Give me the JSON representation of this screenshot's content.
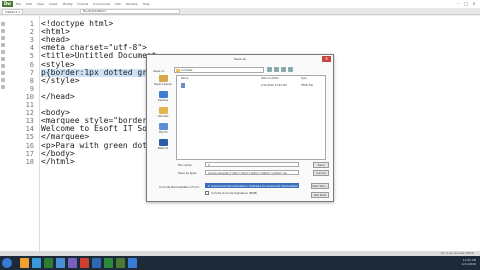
{
  "app": {
    "logo": "Dw",
    "menus": [
      "File",
      "Edit",
      "View",
      "Insert",
      "Modify",
      "Format",
      "Commands",
      "Site",
      "Window",
      "Help"
    ],
    "window_controls": [
      "–",
      "□",
      "✕"
    ]
  },
  "toolbar": {
    "doc_tab": "Untitled-1",
    "file_path": "file:///C|/Untitled-1",
    "doc_tab_close": "×"
  },
  "editor": {
    "lines": [
      {
        "num": "1",
        "text": "<!doctype html>"
      },
      {
        "num": "2",
        "text": "<html>"
      },
      {
        "num": "3",
        "text": "<head>"
      },
      {
        "num": "4",
        "text": "<meta charset=\"utf-8\">"
      },
      {
        "num": "5",
        "text": "<title>Untitled Document"
      },
      {
        "num": "6",
        "text": "<style>"
      },
      {
        "num": "7",
        "text": "p{border:1px dotted gree"
      },
      {
        "num": "8",
        "text": "</style>"
      },
      {
        "num": "9",
        "text": ""
      },
      {
        "num": "10",
        "text": "</head>"
      },
      {
        "num": "11",
        "text": ""
      },
      {
        "num": "12",
        "text": "<body>"
      },
      {
        "num": "13",
        "text": "<marquee style=\"border:2"
      },
      {
        "num": "14",
        "text": "Welcome to Esoft IT Solu"
      },
      {
        "num": "15",
        "text": "</marquee>"
      },
      {
        "num": "16",
        "text": "<p>Para with green dotte"
      },
      {
        "num": "17",
        "text": "</body>"
      },
      {
        "num": "18",
        "text": "</html>"
      }
    ]
  },
  "dialog": {
    "title": "Save As",
    "close": "✕",
    "save_in_label": "Save in:",
    "save_in_value": "number",
    "places": [
      "Recent places",
      "Desktop",
      "Libraries",
      "This PC",
      "Network"
    ],
    "columns": {
      "name": "Name",
      "date": "Date modified",
      "type": "Type"
    },
    "file_row": {
      "date": "1/11/2016 11:03 AM",
      "type": "HTML File"
    },
    "file_name_label": "File name:",
    "file_name_value": "2",
    "save_as_type_label": "Save as type:",
    "save_as_type_value": "All Documents (*.htm;*.html;*.shtm;*.shtml;*.xhtml;*.sh",
    "unicode_label": "Unicode Normalization Form:",
    "unicode_value": "C (Canonical Decomposition, followed by Canonical Composition)",
    "bom_label": "Include Unicode Signature (BOM)",
    "save_btn": "Save",
    "cancel_btn": "Cancel",
    "new_site_btn": "New Site...",
    "site_root_btn": "Site Root"
  },
  "statusbar": {
    "text": "1K / 1 sec  Unicode (UTF-8)"
  },
  "taskbar": {
    "time": "11:05 AM",
    "date": "1/11/2016",
    "icon_colors": [
      "#f0a030",
      "#3a9ad9",
      "#2e7d32",
      "#4a90d9",
      "#7a5fbf",
      "#d04030",
      "#2d6ab0",
      "#2c8a3c",
      "#4c7a34",
      "#3a7bd5"
    ]
  },
  "colors": {
    "selection": "#cde0f5",
    "dialog_close": "#c9463d",
    "field_selected": "#3b6fbd"
  }
}
